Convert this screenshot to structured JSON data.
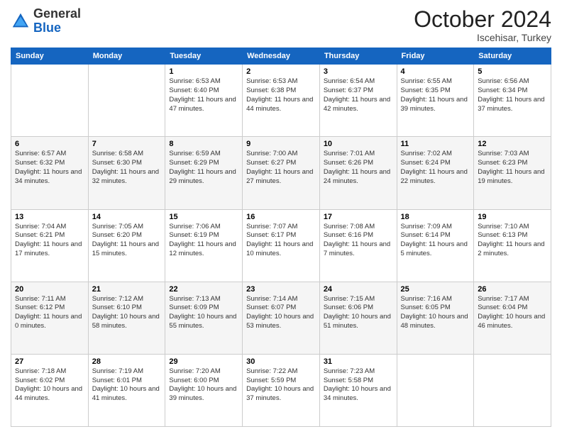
{
  "header": {
    "logo": {
      "line1": "General",
      "line2": "Blue"
    },
    "month": "October 2024",
    "location": "Iscehisar, Turkey"
  },
  "weekdays": [
    "Sunday",
    "Monday",
    "Tuesday",
    "Wednesday",
    "Thursday",
    "Friday",
    "Saturday"
  ],
  "weeks": [
    [
      {
        "day": "",
        "sunrise": "",
        "sunset": "",
        "daylight": ""
      },
      {
        "day": "",
        "sunrise": "",
        "sunset": "",
        "daylight": ""
      },
      {
        "day": "1",
        "sunrise": "Sunrise: 6:53 AM",
        "sunset": "Sunset: 6:40 PM",
        "daylight": "Daylight: 11 hours and 47 minutes."
      },
      {
        "day": "2",
        "sunrise": "Sunrise: 6:53 AM",
        "sunset": "Sunset: 6:38 PM",
        "daylight": "Daylight: 11 hours and 44 minutes."
      },
      {
        "day": "3",
        "sunrise": "Sunrise: 6:54 AM",
        "sunset": "Sunset: 6:37 PM",
        "daylight": "Daylight: 11 hours and 42 minutes."
      },
      {
        "day": "4",
        "sunrise": "Sunrise: 6:55 AM",
        "sunset": "Sunset: 6:35 PM",
        "daylight": "Daylight: 11 hours and 39 minutes."
      },
      {
        "day": "5",
        "sunrise": "Sunrise: 6:56 AM",
        "sunset": "Sunset: 6:34 PM",
        "daylight": "Daylight: 11 hours and 37 minutes."
      }
    ],
    [
      {
        "day": "6",
        "sunrise": "Sunrise: 6:57 AM",
        "sunset": "Sunset: 6:32 PM",
        "daylight": "Daylight: 11 hours and 34 minutes."
      },
      {
        "day": "7",
        "sunrise": "Sunrise: 6:58 AM",
        "sunset": "Sunset: 6:30 PM",
        "daylight": "Daylight: 11 hours and 32 minutes."
      },
      {
        "day": "8",
        "sunrise": "Sunrise: 6:59 AM",
        "sunset": "Sunset: 6:29 PM",
        "daylight": "Daylight: 11 hours and 29 minutes."
      },
      {
        "day": "9",
        "sunrise": "Sunrise: 7:00 AM",
        "sunset": "Sunset: 6:27 PM",
        "daylight": "Daylight: 11 hours and 27 minutes."
      },
      {
        "day": "10",
        "sunrise": "Sunrise: 7:01 AM",
        "sunset": "Sunset: 6:26 PM",
        "daylight": "Daylight: 11 hours and 24 minutes."
      },
      {
        "day": "11",
        "sunrise": "Sunrise: 7:02 AM",
        "sunset": "Sunset: 6:24 PM",
        "daylight": "Daylight: 11 hours and 22 minutes."
      },
      {
        "day": "12",
        "sunrise": "Sunrise: 7:03 AM",
        "sunset": "Sunset: 6:23 PM",
        "daylight": "Daylight: 11 hours and 19 minutes."
      }
    ],
    [
      {
        "day": "13",
        "sunrise": "Sunrise: 7:04 AM",
        "sunset": "Sunset: 6:21 PM",
        "daylight": "Daylight: 11 hours and 17 minutes."
      },
      {
        "day": "14",
        "sunrise": "Sunrise: 7:05 AM",
        "sunset": "Sunset: 6:20 PM",
        "daylight": "Daylight: 11 hours and 15 minutes."
      },
      {
        "day": "15",
        "sunrise": "Sunrise: 7:06 AM",
        "sunset": "Sunset: 6:19 PM",
        "daylight": "Daylight: 11 hours and 12 minutes."
      },
      {
        "day": "16",
        "sunrise": "Sunrise: 7:07 AM",
        "sunset": "Sunset: 6:17 PM",
        "daylight": "Daylight: 11 hours and 10 minutes."
      },
      {
        "day": "17",
        "sunrise": "Sunrise: 7:08 AM",
        "sunset": "Sunset: 6:16 PM",
        "daylight": "Daylight: 11 hours and 7 minutes."
      },
      {
        "day": "18",
        "sunrise": "Sunrise: 7:09 AM",
        "sunset": "Sunset: 6:14 PM",
        "daylight": "Daylight: 11 hours and 5 minutes."
      },
      {
        "day": "19",
        "sunrise": "Sunrise: 7:10 AM",
        "sunset": "Sunset: 6:13 PM",
        "daylight": "Daylight: 11 hours and 2 minutes."
      }
    ],
    [
      {
        "day": "20",
        "sunrise": "Sunrise: 7:11 AM",
        "sunset": "Sunset: 6:12 PM",
        "daylight": "Daylight: 11 hours and 0 minutes."
      },
      {
        "day": "21",
        "sunrise": "Sunrise: 7:12 AM",
        "sunset": "Sunset: 6:10 PM",
        "daylight": "Daylight: 10 hours and 58 minutes."
      },
      {
        "day": "22",
        "sunrise": "Sunrise: 7:13 AM",
        "sunset": "Sunset: 6:09 PM",
        "daylight": "Daylight: 10 hours and 55 minutes."
      },
      {
        "day": "23",
        "sunrise": "Sunrise: 7:14 AM",
        "sunset": "Sunset: 6:07 PM",
        "daylight": "Daylight: 10 hours and 53 minutes."
      },
      {
        "day": "24",
        "sunrise": "Sunrise: 7:15 AM",
        "sunset": "Sunset: 6:06 PM",
        "daylight": "Daylight: 10 hours and 51 minutes."
      },
      {
        "day": "25",
        "sunrise": "Sunrise: 7:16 AM",
        "sunset": "Sunset: 6:05 PM",
        "daylight": "Daylight: 10 hours and 48 minutes."
      },
      {
        "day": "26",
        "sunrise": "Sunrise: 7:17 AM",
        "sunset": "Sunset: 6:04 PM",
        "daylight": "Daylight: 10 hours and 46 minutes."
      }
    ],
    [
      {
        "day": "27",
        "sunrise": "Sunrise: 7:18 AM",
        "sunset": "Sunset: 6:02 PM",
        "daylight": "Daylight: 10 hours and 44 minutes."
      },
      {
        "day": "28",
        "sunrise": "Sunrise: 7:19 AM",
        "sunset": "Sunset: 6:01 PM",
        "daylight": "Daylight: 10 hours and 41 minutes."
      },
      {
        "day": "29",
        "sunrise": "Sunrise: 7:20 AM",
        "sunset": "Sunset: 6:00 PM",
        "daylight": "Daylight: 10 hours and 39 minutes."
      },
      {
        "day": "30",
        "sunrise": "Sunrise: 7:22 AM",
        "sunset": "Sunset: 5:59 PM",
        "daylight": "Daylight: 10 hours and 37 minutes."
      },
      {
        "day": "31",
        "sunrise": "Sunrise: 7:23 AM",
        "sunset": "Sunset: 5:58 PM",
        "daylight": "Daylight: 10 hours and 34 minutes."
      },
      {
        "day": "",
        "sunrise": "",
        "sunset": "",
        "daylight": ""
      },
      {
        "day": "",
        "sunrise": "",
        "sunset": "",
        "daylight": ""
      }
    ]
  ]
}
